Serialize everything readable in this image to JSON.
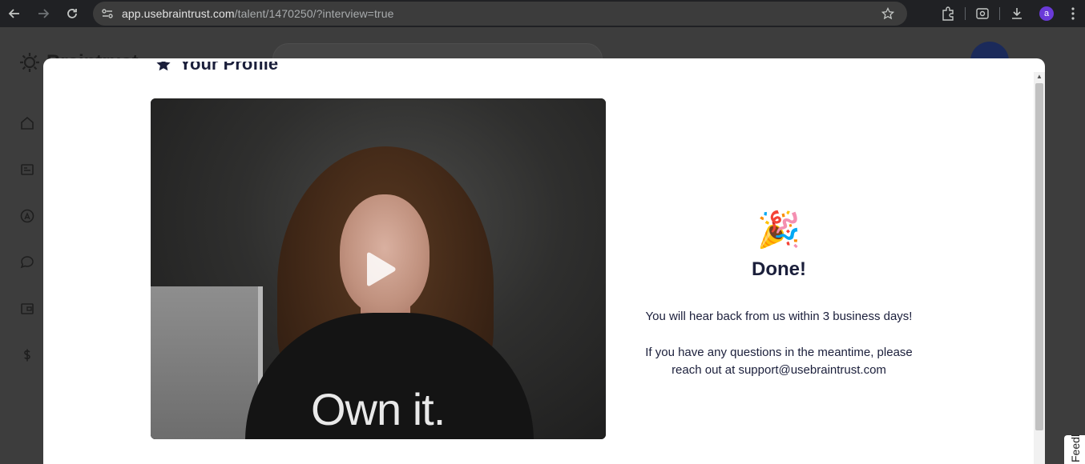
{
  "browser": {
    "url_host": "app.usebraintrust.com",
    "url_path": "/talent/1470250/?interview=true",
    "profile_initial": "a"
  },
  "app": {
    "logo_text": "Braintrust",
    "sidebar_icons": [
      "home-icon",
      "jobs-icon",
      "talent-icon",
      "messages-icon",
      "wallet-icon",
      "dollar-icon"
    ],
    "feedback_label": "Feedback"
  },
  "modal": {
    "partial_title": "Your Profile",
    "video": {
      "shirt_text": "Own it.",
      "state": "paused"
    },
    "done": {
      "emoji": "🎉",
      "title": "Done!",
      "message": "You will hear back from us within 3 business days!",
      "question_line1": "If you have any questions in the meantime, please",
      "question_line2_prefix": "reach out at ",
      "support_email": "support@usebraintrust.com"
    }
  },
  "colors": {
    "heading": "#1b1f3b",
    "chrome_bg": "#202124",
    "overlay": "#3d3d3d"
  }
}
